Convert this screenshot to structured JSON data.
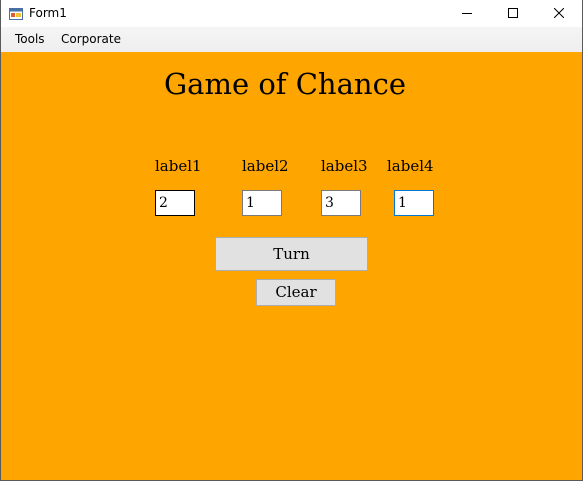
{
  "window": {
    "title": "Form1",
    "app_icon": "winforms-app-icon",
    "controls": {
      "minimize_icon": "minimize-icon",
      "maximize_icon": "maximize-icon",
      "close_icon": "close-icon"
    }
  },
  "menu": {
    "items": [
      {
        "label": "Tools"
      },
      {
        "label": "Corporate"
      }
    ]
  },
  "form": {
    "background_color": "#ffa500",
    "heading": "Game of Chance",
    "labels": [
      "label1",
      "label2",
      "label3",
      "label4"
    ],
    "fields": [
      {
        "value": "2"
      },
      {
        "value": "1"
      },
      {
        "value": "3"
      },
      {
        "value": "1"
      }
    ],
    "turn_button_label": "Turn",
    "clear_button_label": "Clear"
  }
}
